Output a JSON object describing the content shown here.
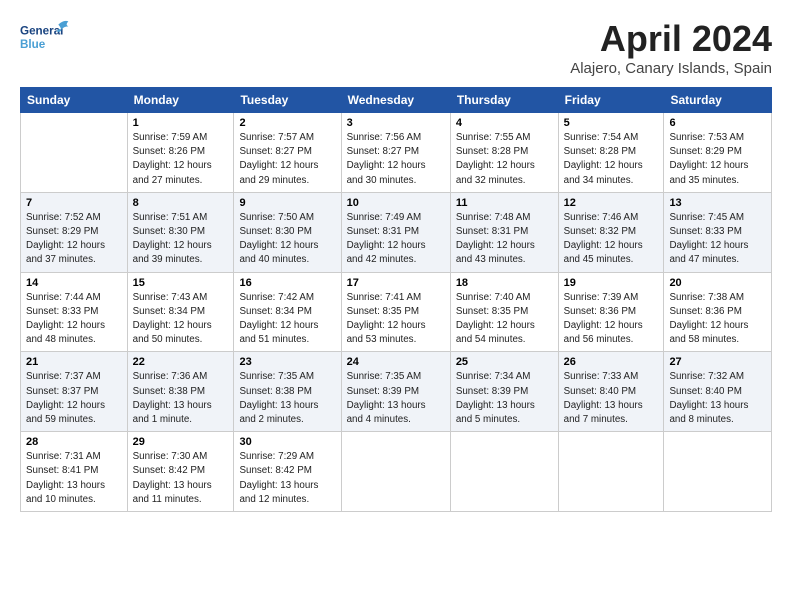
{
  "header": {
    "logo_general": "General",
    "logo_blue": "Blue",
    "title": "April 2024",
    "location": "Alajero, Canary Islands, Spain"
  },
  "weekdays": [
    "Sunday",
    "Monday",
    "Tuesday",
    "Wednesday",
    "Thursday",
    "Friday",
    "Saturday"
  ],
  "weeks": [
    [
      {
        "day": "",
        "info": ""
      },
      {
        "day": "1",
        "info": "Sunrise: 7:59 AM\nSunset: 8:26 PM\nDaylight: 12 hours\nand 27 minutes."
      },
      {
        "day": "2",
        "info": "Sunrise: 7:57 AM\nSunset: 8:27 PM\nDaylight: 12 hours\nand 29 minutes."
      },
      {
        "day": "3",
        "info": "Sunrise: 7:56 AM\nSunset: 8:27 PM\nDaylight: 12 hours\nand 30 minutes."
      },
      {
        "day": "4",
        "info": "Sunrise: 7:55 AM\nSunset: 8:28 PM\nDaylight: 12 hours\nand 32 minutes."
      },
      {
        "day": "5",
        "info": "Sunrise: 7:54 AM\nSunset: 8:28 PM\nDaylight: 12 hours\nand 34 minutes."
      },
      {
        "day": "6",
        "info": "Sunrise: 7:53 AM\nSunset: 8:29 PM\nDaylight: 12 hours\nand 35 minutes."
      }
    ],
    [
      {
        "day": "7",
        "info": "Sunrise: 7:52 AM\nSunset: 8:29 PM\nDaylight: 12 hours\nand 37 minutes."
      },
      {
        "day": "8",
        "info": "Sunrise: 7:51 AM\nSunset: 8:30 PM\nDaylight: 12 hours\nand 39 minutes."
      },
      {
        "day": "9",
        "info": "Sunrise: 7:50 AM\nSunset: 8:30 PM\nDaylight: 12 hours\nand 40 minutes."
      },
      {
        "day": "10",
        "info": "Sunrise: 7:49 AM\nSunset: 8:31 PM\nDaylight: 12 hours\nand 42 minutes."
      },
      {
        "day": "11",
        "info": "Sunrise: 7:48 AM\nSunset: 8:31 PM\nDaylight: 12 hours\nand 43 minutes."
      },
      {
        "day": "12",
        "info": "Sunrise: 7:46 AM\nSunset: 8:32 PM\nDaylight: 12 hours\nand 45 minutes."
      },
      {
        "day": "13",
        "info": "Sunrise: 7:45 AM\nSunset: 8:33 PM\nDaylight: 12 hours\nand 47 minutes."
      }
    ],
    [
      {
        "day": "14",
        "info": "Sunrise: 7:44 AM\nSunset: 8:33 PM\nDaylight: 12 hours\nand 48 minutes."
      },
      {
        "day": "15",
        "info": "Sunrise: 7:43 AM\nSunset: 8:34 PM\nDaylight: 12 hours\nand 50 minutes."
      },
      {
        "day": "16",
        "info": "Sunrise: 7:42 AM\nSunset: 8:34 PM\nDaylight: 12 hours\nand 51 minutes."
      },
      {
        "day": "17",
        "info": "Sunrise: 7:41 AM\nSunset: 8:35 PM\nDaylight: 12 hours\nand 53 minutes."
      },
      {
        "day": "18",
        "info": "Sunrise: 7:40 AM\nSunset: 8:35 PM\nDaylight: 12 hours\nand 54 minutes."
      },
      {
        "day": "19",
        "info": "Sunrise: 7:39 AM\nSunset: 8:36 PM\nDaylight: 12 hours\nand 56 minutes."
      },
      {
        "day": "20",
        "info": "Sunrise: 7:38 AM\nSunset: 8:36 PM\nDaylight: 12 hours\nand 58 minutes."
      }
    ],
    [
      {
        "day": "21",
        "info": "Sunrise: 7:37 AM\nSunset: 8:37 PM\nDaylight: 12 hours\nand 59 minutes."
      },
      {
        "day": "22",
        "info": "Sunrise: 7:36 AM\nSunset: 8:38 PM\nDaylight: 13 hours\nand 1 minute."
      },
      {
        "day": "23",
        "info": "Sunrise: 7:35 AM\nSunset: 8:38 PM\nDaylight: 13 hours\nand 2 minutes."
      },
      {
        "day": "24",
        "info": "Sunrise: 7:35 AM\nSunset: 8:39 PM\nDaylight: 13 hours\nand 4 minutes."
      },
      {
        "day": "25",
        "info": "Sunrise: 7:34 AM\nSunset: 8:39 PM\nDaylight: 13 hours\nand 5 minutes."
      },
      {
        "day": "26",
        "info": "Sunrise: 7:33 AM\nSunset: 8:40 PM\nDaylight: 13 hours\nand 7 minutes."
      },
      {
        "day": "27",
        "info": "Sunrise: 7:32 AM\nSunset: 8:40 PM\nDaylight: 13 hours\nand 8 minutes."
      }
    ],
    [
      {
        "day": "28",
        "info": "Sunrise: 7:31 AM\nSunset: 8:41 PM\nDaylight: 13 hours\nand 10 minutes."
      },
      {
        "day": "29",
        "info": "Sunrise: 7:30 AM\nSunset: 8:42 PM\nDaylight: 13 hours\nand 11 minutes."
      },
      {
        "day": "30",
        "info": "Sunrise: 7:29 AM\nSunset: 8:42 PM\nDaylight: 13 hours\nand 12 minutes."
      },
      {
        "day": "",
        "info": ""
      },
      {
        "day": "",
        "info": ""
      },
      {
        "day": "",
        "info": ""
      },
      {
        "day": "",
        "info": ""
      }
    ]
  ]
}
